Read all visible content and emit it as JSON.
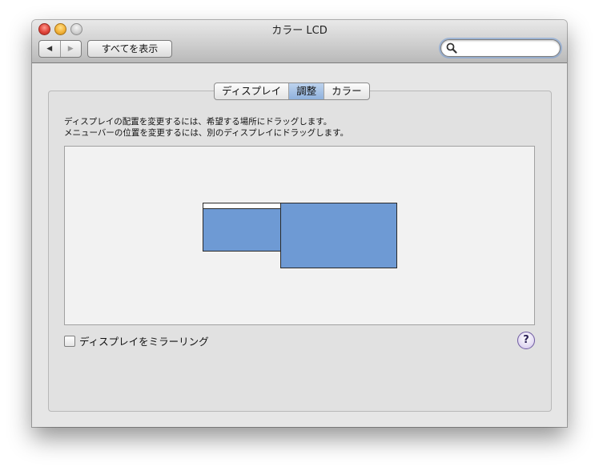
{
  "window": {
    "title": "カラー LCD"
  },
  "toolbar": {
    "back_icon": "◀",
    "forward_icon": "▶",
    "show_all_label": "すべてを表示",
    "search_value": ""
  },
  "tabs": [
    {
      "label": "ディスプレイ",
      "selected": false
    },
    {
      "label": "調整",
      "selected": true
    },
    {
      "label": "カラー",
      "selected": false
    }
  ],
  "instructions": {
    "line1": "ディスプレイの配置を変更するには、希望する場所にドラッグします。",
    "line2": "メニューバーの位置を変更するには、別のディスプレイにドラッグします。"
  },
  "mirror": {
    "label": "ディスプレイをミラーリング",
    "checked": false
  },
  "help": {
    "label": "?"
  },
  "colors": {
    "display_fill": "#6e9ad4",
    "selected_tab": "#a6c2e6"
  }
}
